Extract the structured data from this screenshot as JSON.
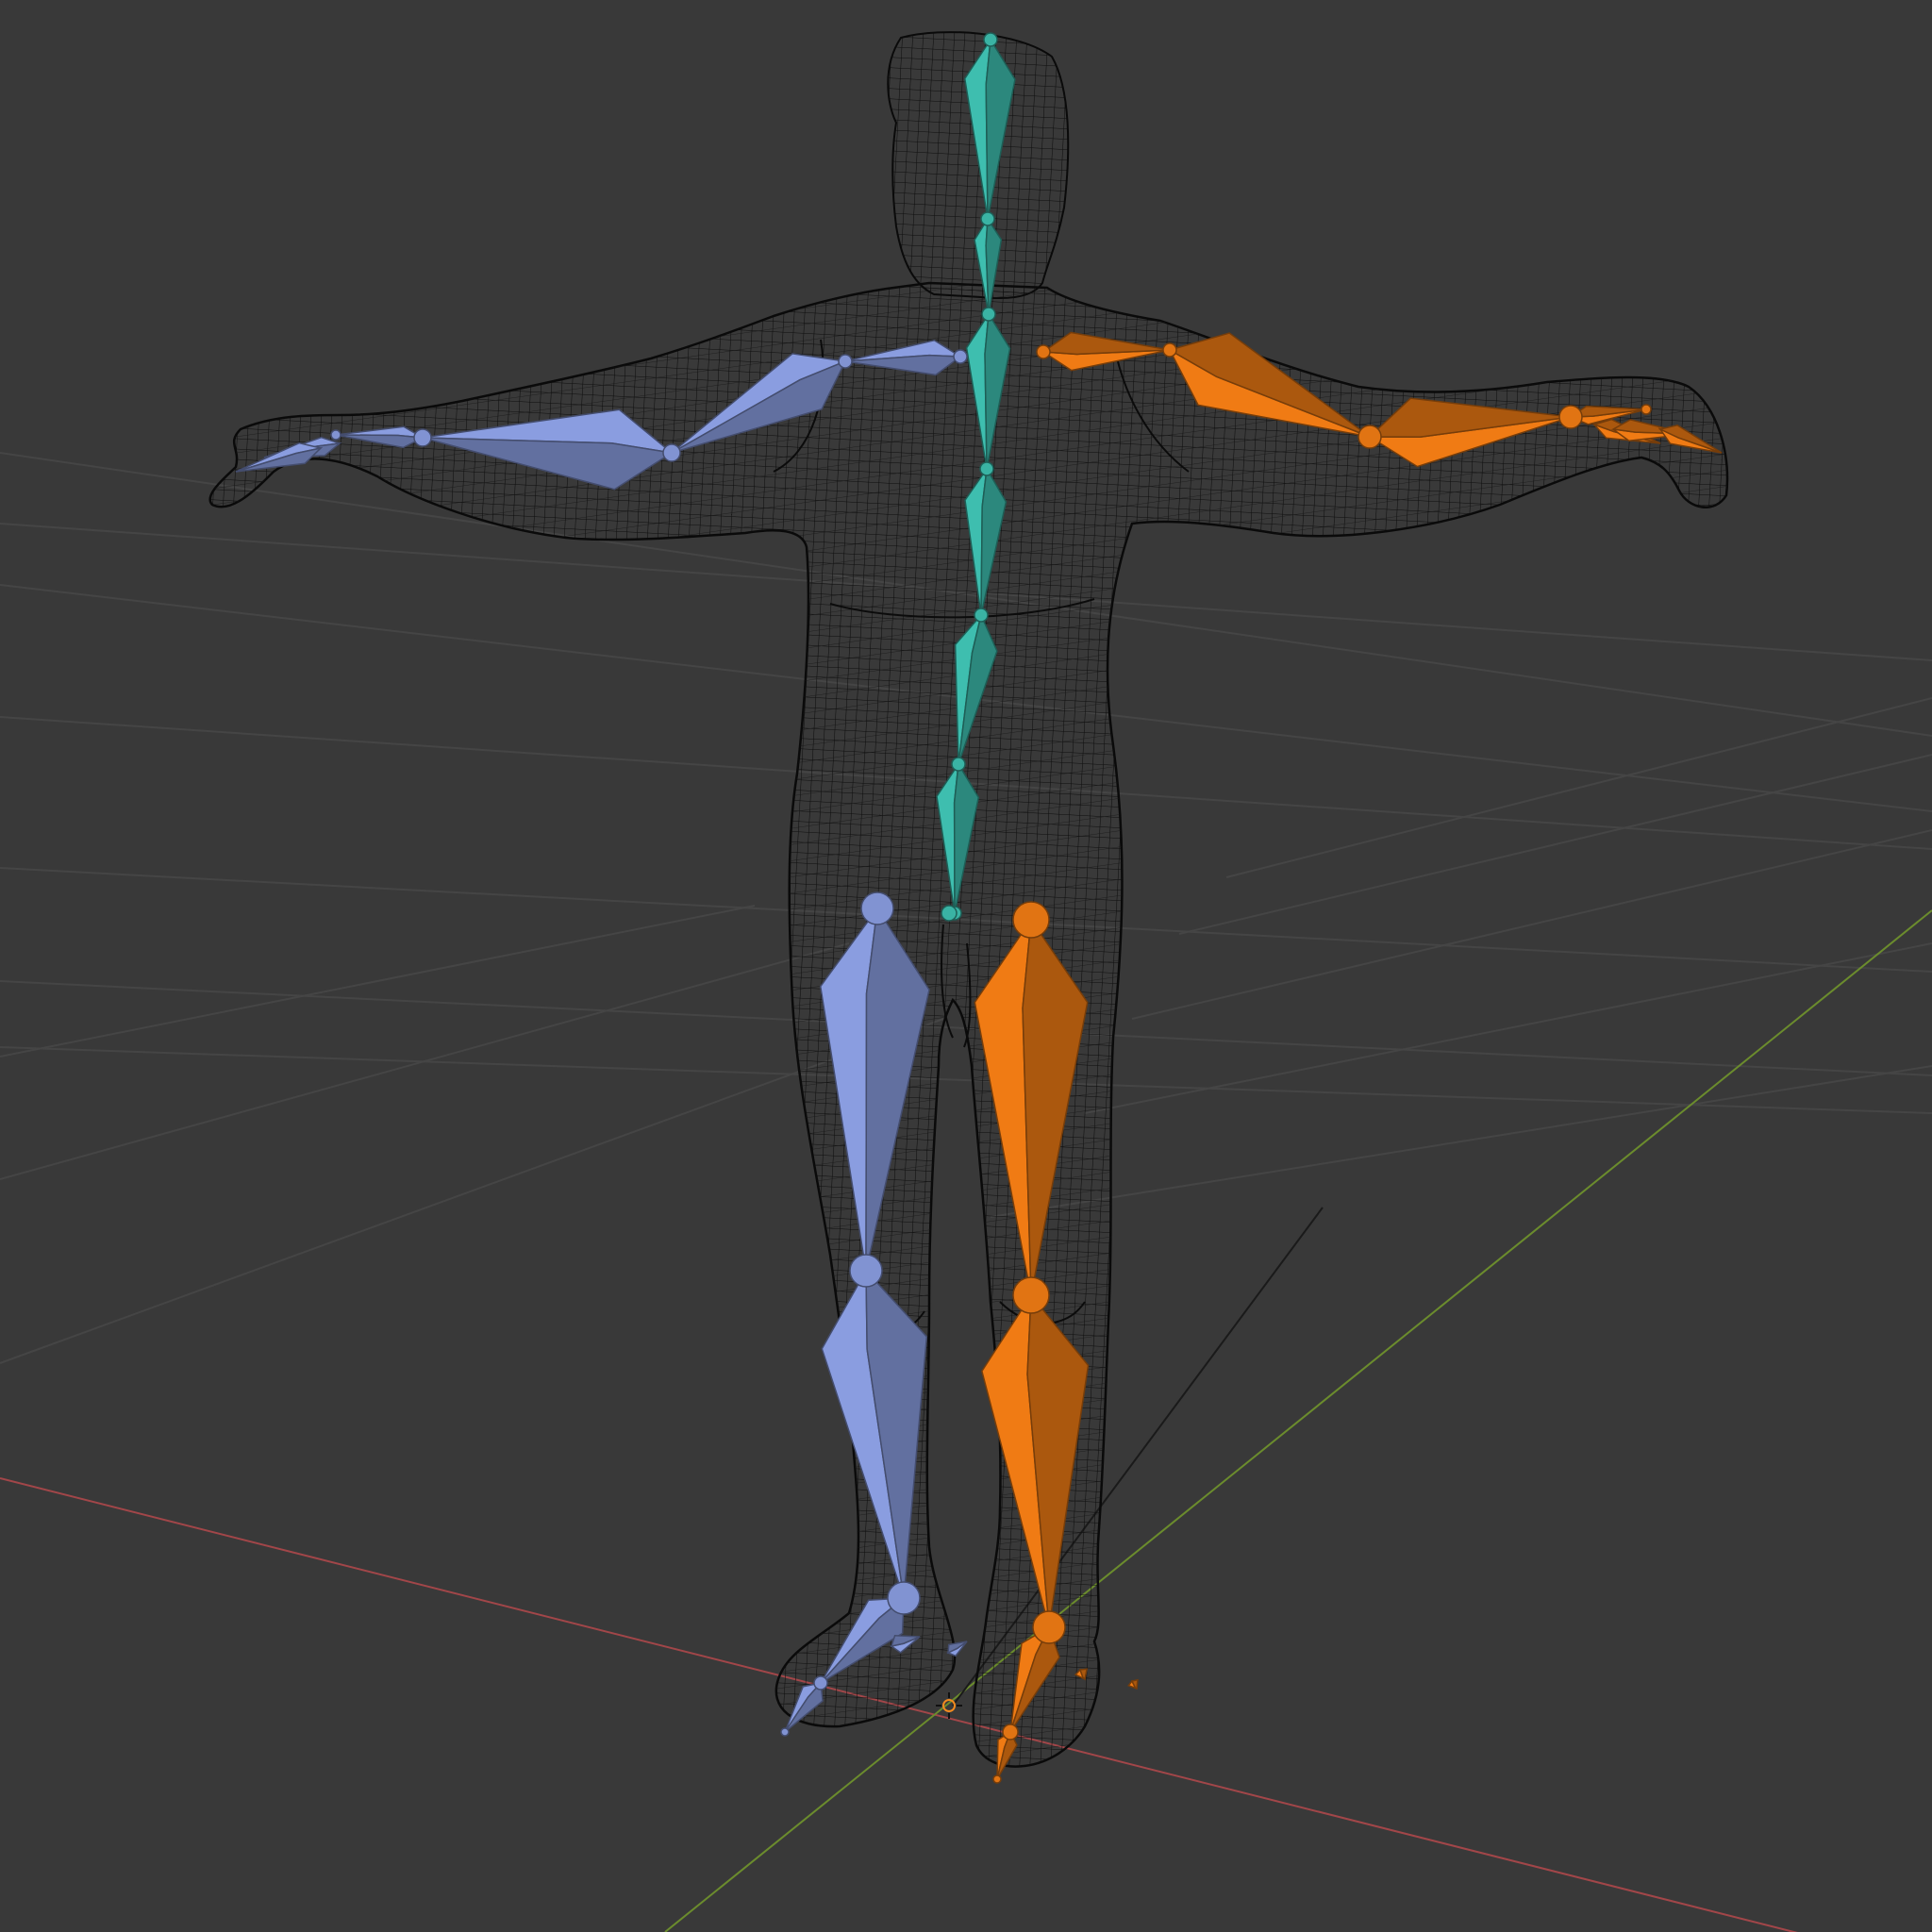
{
  "viewport": {
    "background_color": "#393939",
    "grid_color": "#454545",
    "x_axis_color": "#a24649",
    "y_axis_color": "#6b8c2d",
    "z_axis_color": "#1c1c1c",
    "wireframe_color": "#0e0e0e",
    "scene_objects": [
      "character-mesh-wireframe",
      "armature"
    ],
    "view_mode": "wireframe",
    "pose": "T-pose"
  },
  "armature": {
    "spine_color": "#37aa9c",
    "left_side_color": "#7b8cc8",
    "right_side_color": "#d66e12",
    "bone_groups": [
      "spine",
      "left-arm",
      "right-arm",
      "left-leg",
      "right-leg"
    ],
    "bone_shape": "octahedral"
  },
  "origin_marker": {
    "icon": "origin-crosshair-icon",
    "color": "#f28a1f"
  }
}
